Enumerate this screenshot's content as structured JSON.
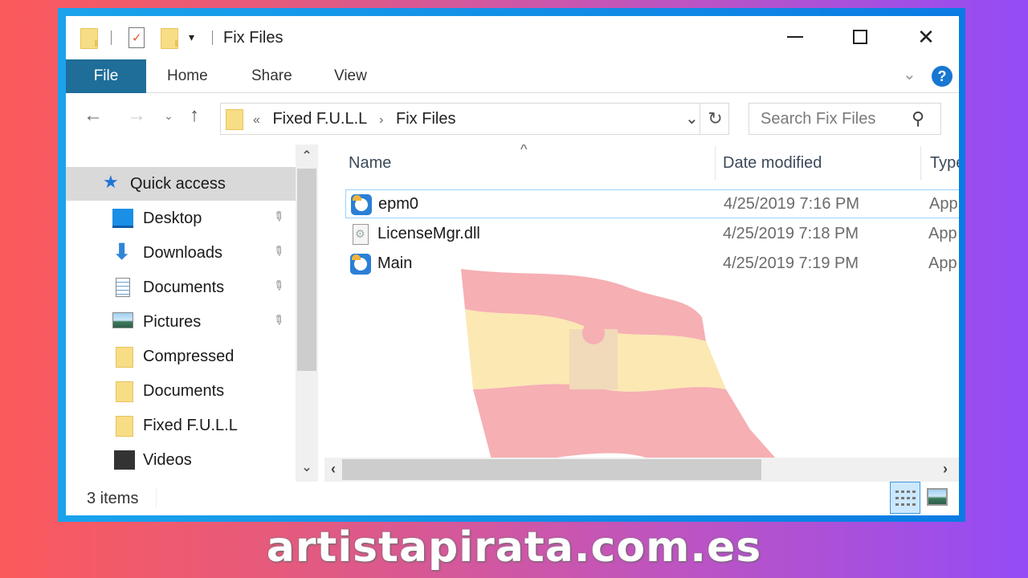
{
  "window": {
    "title": "Fix Files",
    "controls": {
      "minimize": "minimize",
      "maximize": "maximize",
      "close": "✕"
    }
  },
  "quick_access_toolbar": {
    "items": [
      "folder-icon",
      "properties-icon",
      "new-folder-icon"
    ],
    "dropdown": "▾"
  },
  "ribbon": {
    "tabs": [
      {
        "label": "File",
        "active": true
      },
      {
        "label": "Home"
      },
      {
        "label": "Share"
      },
      {
        "label": "View"
      }
    ],
    "expand_icon": "⌄",
    "help_icon": "?"
  },
  "navigation": {
    "back": "←",
    "forward": "→",
    "recent": "⌄",
    "up": "↑",
    "address": {
      "overflow": "«",
      "crumbs": [
        "Fixed F.U.L.L",
        "Fix Files"
      ],
      "separator": "›",
      "dropdown": "⌄",
      "refresh": "↻"
    },
    "search": {
      "placeholder": "Search Fix Files",
      "value": "",
      "icon": "⚲"
    }
  },
  "nav_pane": {
    "items": [
      {
        "label": "Quick access",
        "icon": "star-icon",
        "selected": true,
        "pinned": false
      },
      {
        "label": "Desktop",
        "icon": "desktop-icon",
        "pinned": true
      },
      {
        "label": "Downloads",
        "icon": "downloads-icon",
        "pinned": true
      },
      {
        "label": "Documents",
        "icon": "documents-icon",
        "pinned": true
      },
      {
        "label": "Pictures",
        "icon": "pictures-icon",
        "pinned": true
      },
      {
        "label": "Compressed",
        "icon": "folder-icon",
        "pinned": false
      },
      {
        "label": "Documents",
        "icon": "folder-icon",
        "pinned": false
      },
      {
        "label": "Fixed F.U.L.L",
        "icon": "folder-icon",
        "pinned": false
      },
      {
        "label": "Videos",
        "icon": "videos-icon",
        "pinned": false
      }
    ],
    "pin_glyph": "📌",
    "scroll_up": "⌃",
    "scroll_down": "⌄"
  },
  "file_list": {
    "columns": [
      "Name",
      "Date modified",
      "Type"
    ],
    "sort_indicator": "^",
    "files": [
      {
        "name": "epm0",
        "date": "4/25/2019 7:16 PM",
        "type": "App",
        "icon": "application-icon",
        "focused": true
      },
      {
        "name": "LicenseMgr.dll",
        "date": "4/25/2019 7:18 PM",
        "type": "App",
        "icon": "dll-icon"
      },
      {
        "name": "Main",
        "date": "4/25/2019 7:19 PM",
        "type": "App",
        "icon": "application-icon"
      }
    ],
    "scroll_left": "‹",
    "scroll_right": "›"
  },
  "status_bar": {
    "item_count": "3 items",
    "views": [
      "details-view",
      "large-icons-view"
    ],
    "active_view": "details-view"
  },
  "overlay": {
    "watermark": "artistapirata.com.es",
    "flag": "spain-flag"
  },
  "colors": {
    "file_tab": "#1f6d99",
    "window_border": "#1aa3ec",
    "selection_focus": "#99d1ff",
    "flag_red": "#e8303a",
    "flag_yellow": "#f6c53a"
  }
}
